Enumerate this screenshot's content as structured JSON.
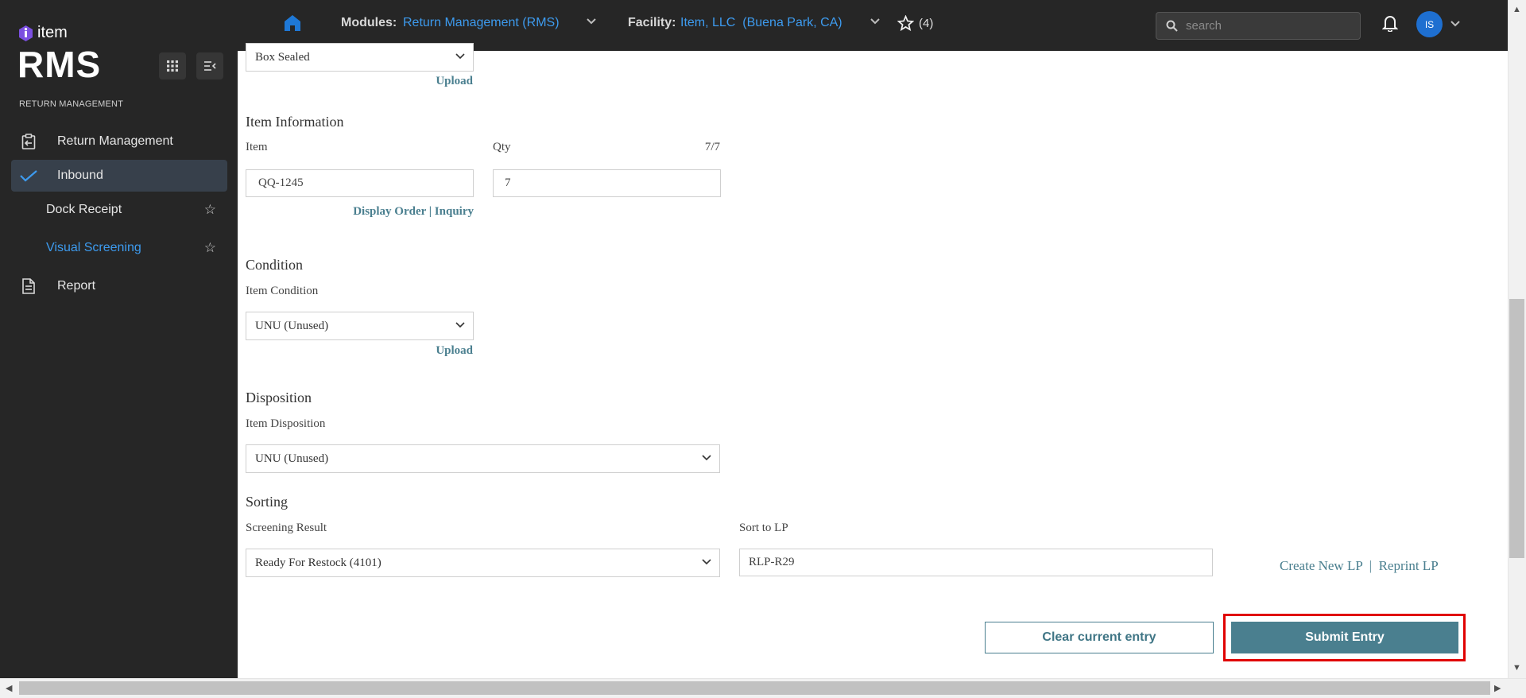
{
  "brand": {
    "logo_text": "item",
    "app_name": "RMS",
    "section_label": "RETURN MANAGEMENT"
  },
  "sidebar": {
    "items": [
      {
        "label": "Return Management",
        "icon": "return-icon"
      },
      {
        "label": "Inbound",
        "icon": "check-icon",
        "active": true
      },
      {
        "label": "Dock Receipt",
        "sub": true,
        "icon": "star-icon"
      },
      {
        "label": "Visual Screening",
        "sub": true,
        "selected": true,
        "icon": "star-icon"
      },
      {
        "label": "Report",
        "icon": "report-icon"
      }
    ]
  },
  "topbar": {
    "modules_label": "Modules:",
    "modules_value": "Return Management (RMS)",
    "facility_label": "Facility:",
    "facility_value": "Item, LLC  (Buena Park, CA)",
    "favorites_count": "(4)",
    "search_placeholder": "search",
    "avatar_initials": "IS"
  },
  "form": {
    "top_select_value": "Box Sealed",
    "top_upload": "Upload",
    "item_info": {
      "title": "Item Information",
      "item_label": "Item",
      "qty_label": "Qty",
      "qty_counter": "7/7",
      "item_value": "QQ-1245",
      "qty_value": "7",
      "display_order_link": "Display Order | Inquiry"
    },
    "condition": {
      "title": "Condition",
      "label": "Item Condition",
      "value": "UNU (Unused)",
      "upload": "Upload"
    },
    "disposition": {
      "title": "Disposition",
      "label": "Item Disposition",
      "value": "UNU (Unused)"
    },
    "sorting": {
      "title": "Sorting",
      "screening_label": "Screening Result",
      "screening_value": "Ready For Restock (4101)",
      "sort_lp_label": "Sort to LP",
      "sort_lp_value": "RLP-R29",
      "lp_links": "Create New LP  |  Reprint LP"
    },
    "buttons": {
      "clear": "Clear current entry",
      "submit": "Submit Entry"
    }
  },
  "colors": {
    "sidebar_bg": "#262626",
    "accent_blue": "#3d9bef",
    "teal": "#4a7f8f",
    "highlight_red": "#e00000"
  }
}
